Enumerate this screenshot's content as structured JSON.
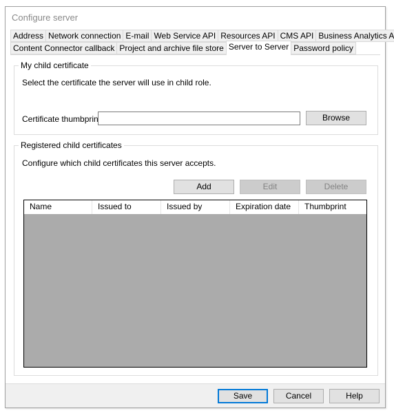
{
  "window": {
    "title": "Configure server"
  },
  "tabs": {
    "row1": [
      "Address",
      "Network connection",
      "E-mail",
      "Web Service API",
      "Resources API",
      "CMS API",
      "Business Analytics API"
    ],
    "row2": [
      "Content Connector callback",
      "Project and archive file store",
      "Server to Server",
      "Password policy"
    ],
    "active": "Server to Server"
  },
  "child_certificate": {
    "legend": "My child certificate",
    "description": "Select the certificate the server will use in child role.",
    "thumbprint_label": "Certificate thumbprint",
    "thumbprint_value": "",
    "browse_label": "Browse"
  },
  "registered": {
    "legend": "Registered child certificates",
    "description": "Configure which child certificates this server accepts.",
    "add_label": "Add",
    "edit_label": "Edit",
    "delete_label": "Delete",
    "columns": [
      "Name",
      "Issued to",
      "Issued by",
      "Expiration date",
      "Thumbprint"
    ],
    "rows": []
  },
  "footer": {
    "save_label": "Save",
    "cancel_label": "Cancel",
    "help_label": "Help"
  }
}
